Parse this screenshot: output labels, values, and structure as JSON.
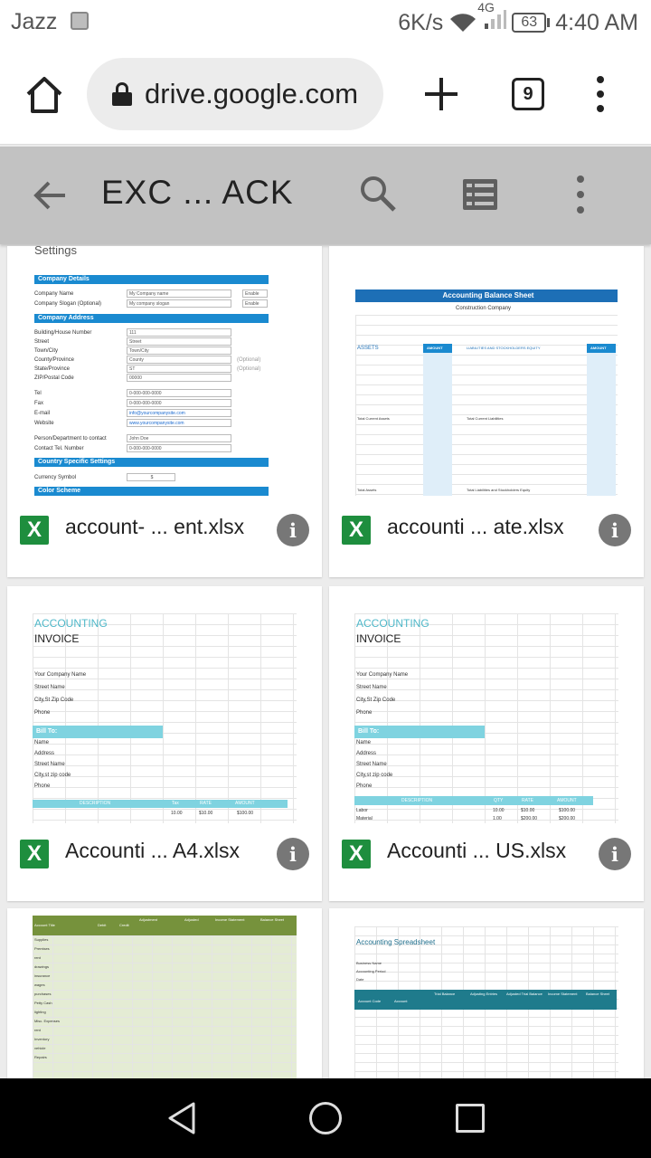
{
  "status_bar": {
    "carrier": "Jazz",
    "speed": "6K/s",
    "network": "4G",
    "battery": "63",
    "time": "4:40 AM"
  },
  "browser": {
    "url": "drive.google.com",
    "tab_count": "9"
  },
  "toolbar": {
    "title": "EXC ... ACK"
  },
  "files": [
    {
      "name": "account- ... ent.xlsx",
      "type_icon": "X"
    },
    {
      "name": "accounti ... ate.xlsx",
      "type_icon": "X"
    },
    {
      "name": "Accounti ... A4.xlsx",
      "type_icon": "X"
    },
    {
      "name": "Accounti ... US.xlsx",
      "type_icon": "X"
    },
    {
      "name": "",
      "type_icon": ""
    },
    {
      "name": "",
      "type_icon": ""
    }
  ],
  "previews": {
    "settings": {
      "top_fragment": "Settings",
      "company_details": "Company Details",
      "company_name_label": "Company Name",
      "company_name_value": "My Company name",
      "company_slogan_label": "Company Slogan (Optional)",
      "company_slogan_value": "My company slogan",
      "enable": "Enable",
      "company_address": "Company Address",
      "addr_labels": [
        "Building/House Number",
        "Street",
        "Town/City",
        "County/Province",
        "State/Province",
        "ZIP/Postal Code"
      ],
      "addr_values": [
        "111",
        "Street",
        "Town/City",
        "County",
        "ST",
        "00000"
      ],
      "optional": "(Optional)",
      "contact_labels": [
        "Tel",
        "Fax",
        "E-mail",
        "Website"
      ],
      "contact_values": [
        "0-000-000-0000",
        "0-000-000-0000",
        "info@yourcompanysite.com",
        "www.yourcompanysite.com"
      ],
      "person_label": "Person/Department to contact",
      "person_value": "John Doe",
      "contact_tel_label": "Contact Tel. Number",
      "contact_tel_value": "0-000-000-0000",
      "country_settings": "Country Specific Settings",
      "currency_label": "Currency Symbol",
      "currency_value": "$",
      "color_scheme": "Color Scheme"
    },
    "balance": {
      "title": "Accounting Balance Sheet",
      "company": "Construction Company",
      "assets": "ASSETS",
      "amount": "AMOUNT",
      "liabilities": "LIABILITIES AND STOCKHOLDERS EQUITY",
      "total_current_assets": "Total Current Assets",
      "total_current_liabilities": "Total Current Liabilities",
      "total_assets": "Total Assets",
      "total_le": "Total Liabilities and Stockholders Equity"
    },
    "invoice": {
      "heading": "ACCOUNTING",
      "sub": "INVOICE",
      "company_lines": [
        "Your Company Name",
        "Street Name",
        "City,St Zip Code",
        "Phone"
      ],
      "bill_to": "Bill To:",
      "bill_lines": [
        "Name",
        "Address",
        "Street Name",
        "City,st zip code",
        "Phone"
      ],
      "cols": [
        "DESCRIPTION",
        "Tax",
        "RATE",
        "AMOUNT"
      ],
      "row": [
        "",
        "10.00",
        "$10.00",
        "$100.00"
      ]
    },
    "invoice_us": {
      "cols": [
        "DESCRIPTION",
        "QTY",
        "RATE",
        "AMOUNT"
      ],
      "row1": [
        "Labor",
        "10.00",
        "$10.00",
        "$100.00"
      ],
      "row2": [
        "Material",
        "1.00",
        "$200.00",
        "$200.00"
      ]
    },
    "worksheet": {
      "headers": [
        "Account Title",
        "Debit",
        "Credit",
        "Adjustment",
        "Adjusted",
        "Income Statement",
        "Balance Sheet"
      ],
      "accounts": [
        "Supplies",
        "Premises",
        "rent",
        "drawings",
        "insurance",
        "wages",
        "purchases",
        "Petty Cash",
        "lighting",
        "Misc. Expenses",
        "rent",
        "Inventory",
        "vehicle",
        "Repairs"
      ]
    },
    "spreadsheet": {
      "title": "Accounting Spreadsheet",
      "labels": [
        "Business Name",
        "Accounting Period",
        "Date"
      ],
      "cols": [
        "Account Code",
        "Account",
        "Trial Balance",
        "Adjusting Entries",
        "Adjusted Trial Balance",
        "Income Statement",
        "Balance Sheet"
      ]
    }
  }
}
